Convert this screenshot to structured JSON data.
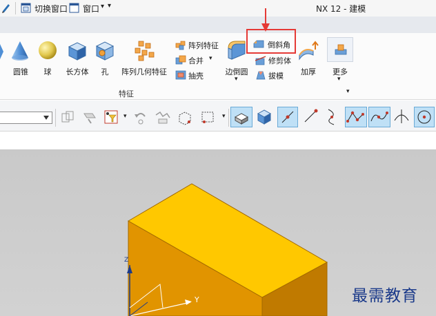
{
  "titlebar": {
    "switch_window": "切换窗口",
    "window_menu": "窗口",
    "window_arrow": "▾",
    "more_arrow": "▾",
    "app_title": "NX 12 - 建模"
  },
  "ribbon": {
    "group_label": "特征",
    "cone": "圆锥",
    "sphere": "球",
    "block": "长方体",
    "hole": "孔",
    "pattern_geometry": "阵列几何特征",
    "pattern_feature": "阵列特征",
    "unite": "合并",
    "shell": "抽壳",
    "edge_blend": "边倒圆",
    "chamfer": "倒斜角",
    "trim_body": "修剪体",
    "draft": "拔模",
    "thicken": "加厚",
    "more": "更多",
    "dropdown_arrow": "▾"
  },
  "watermark": "最需教育",
  "axes": {
    "z": "Z",
    "y": "Y"
  },
  "colors": {
    "highlight_red": "#e53935",
    "box_top": "#ffc800",
    "box_front": "#e19400",
    "box_side": "#c07a00"
  }
}
